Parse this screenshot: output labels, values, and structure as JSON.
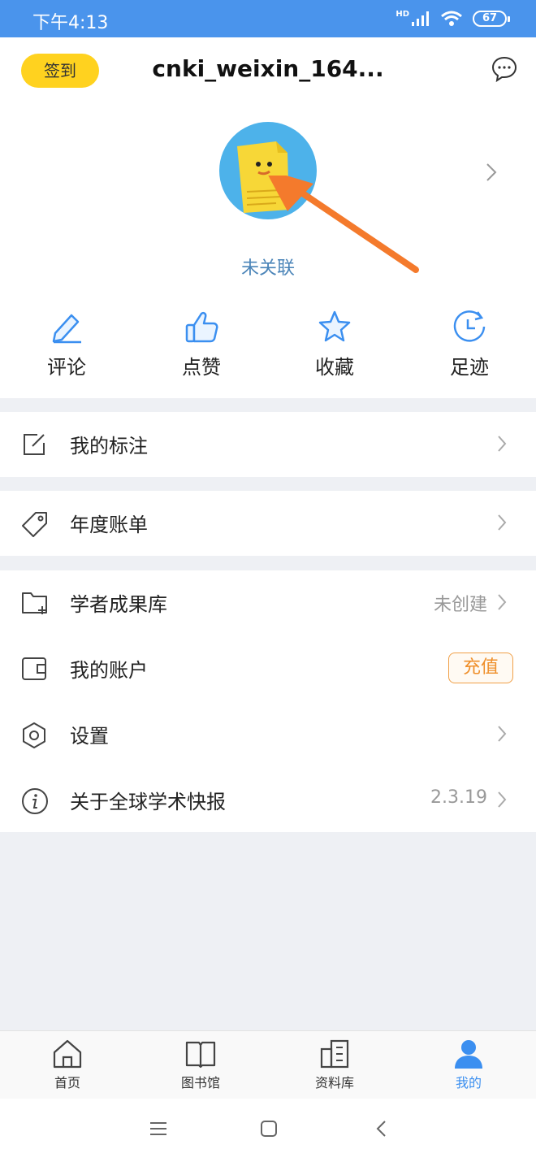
{
  "status_bar": {
    "time": "下午4:13",
    "network": "HD",
    "battery": "67"
  },
  "header": {
    "signin_label": "签到",
    "username": "cnki_weixin_164...",
    "message_icon": "chat-bubble-icon"
  },
  "profile": {
    "avatar_icon": "document-mascot-avatar",
    "link_status": "未关联"
  },
  "quick_actions": [
    {
      "label": "评论",
      "icon": "pencil-icon"
    },
    {
      "label": "点赞",
      "icon": "thumbs-up-icon"
    },
    {
      "label": "收藏",
      "icon": "star-icon"
    },
    {
      "label": "足迹",
      "icon": "history-clock-icon"
    }
  ],
  "menu": {
    "annotations": {
      "label": "我的标注",
      "icon": "edit-square-icon"
    },
    "annual_bill": {
      "label": "年度账单",
      "icon": "tag-icon"
    },
    "scholar_library": {
      "label": "学者成果库",
      "status": "未创建",
      "icon": "folder-plus-icon"
    },
    "my_account": {
      "label": "我的账户",
      "action": "充值",
      "icon": "wallet-icon"
    },
    "settings": {
      "label": "设置",
      "icon": "hexagon-gear-icon"
    },
    "about": {
      "label": "关于全球学术快报",
      "version": "2.3.19",
      "icon": "info-icon"
    }
  },
  "tab_bar": [
    {
      "label": "首页",
      "icon": "home-icon",
      "active": false
    },
    {
      "label": "图书馆",
      "icon": "book-icon",
      "active": false
    },
    {
      "label": "资料库",
      "icon": "buildings-icon",
      "active": false
    },
    {
      "label": "我的",
      "icon": "person-icon",
      "active": true
    }
  ],
  "colors": {
    "accent": "#3b8ff0",
    "status_bar": "#4a94ec",
    "signin": "#ffd21f",
    "recharge": "#ef8f2a",
    "annotation_arrow": "#f47a2c"
  }
}
